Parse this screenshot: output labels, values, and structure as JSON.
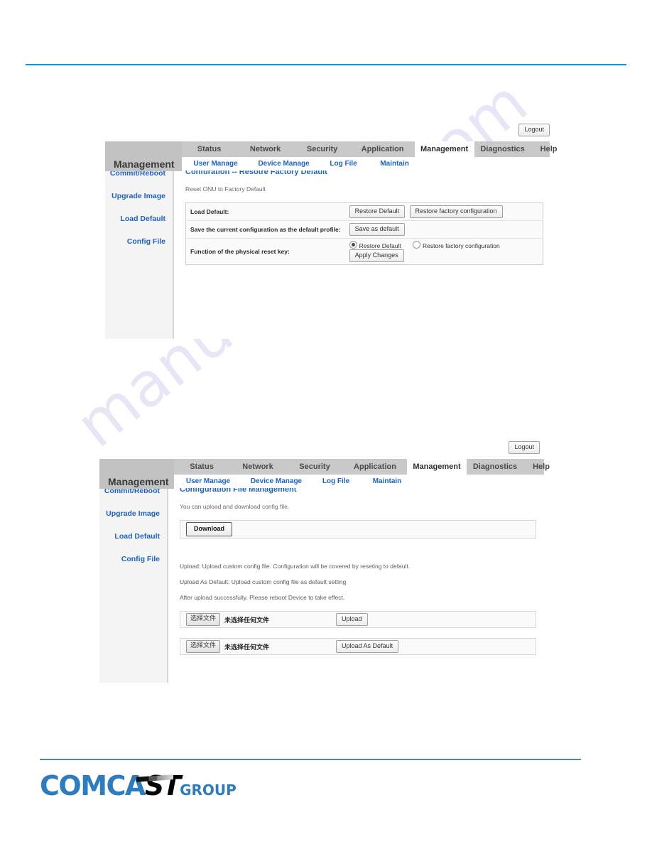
{
  "watermark": {
    "text": "manualshive.com"
  },
  "logo": {
    "part1": "COMCA",
    "part2": "ST",
    "part3": "GROUP",
    "blue": "#2b7cc0",
    "black": "#000000"
  },
  "nav": {
    "brand": "Management",
    "tabs": [
      {
        "label": "Status",
        "active": false
      },
      {
        "label": "Network",
        "active": false
      },
      {
        "label": "Security",
        "active": false
      },
      {
        "label": "Application",
        "active": false
      },
      {
        "label": "Management",
        "active": true
      },
      {
        "label": "Diagnostics",
        "active": false
      },
      {
        "label": "Help",
        "active": false
      }
    ],
    "subtabs": [
      {
        "label": "User Manage"
      },
      {
        "label": "Device Manage"
      },
      {
        "label": "Log File"
      },
      {
        "label": "Maintain"
      }
    ],
    "logout_label": "Logout"
  },
  "sidebar": {
    "items": [
      {
        "label": "Commit/Reboot"
      },
      {
        "label": "Upgrade Image"
      },
      {
        "label": "Load Default"
      },
      {
        "label": "Config File"
      }
    ]
  },
  "panel1": {
    "title": "Confuration -- Resotre Factory Default",
    "description": "Reset ONU to Factory Default",
    "rows": [
      {
        "label": "Load Default:",
        "buttons": [
          "Restore Default",
          "Restore factory configuration"
        ]
      },
      {
        "label": "Save the current configuration as the default profile:",
        "buttons": [
          "Save as default"
        ]
      },
      {
        "label": "Function of the physical reset key:",
        "radios": [
          {
            "label": "Restore Default",
            "selected": true
          },
          {
            "label": "Restore factory configuration",
            "selected": false
          }
        ],
        "apply_label": "Apply Changes"
      }
    ]
  },
  "panel2": {
    "title": "Configuration File Management",
    "description": "You can upload and download config file.",
    "download_label": "Download",
    "notes": [
      "Upload: Upload custom config file. Configuration will be covered by reseting to default.",
      "Upload As Default: Upload custom config file as default setting",
      "After upload successfully. Please reboot Device to take effect."
    ],
    "uploads": [
      {
        "choose_label": "选择文件",
        "file_status": "未选择任何文件",
        "action_label": "Upload"
      },
      {
        "choose_label": "选择文件",
        "file_status": "未选择任何文件",
        "action_label": "Upload As Default"
      }
    ]
  }
}
